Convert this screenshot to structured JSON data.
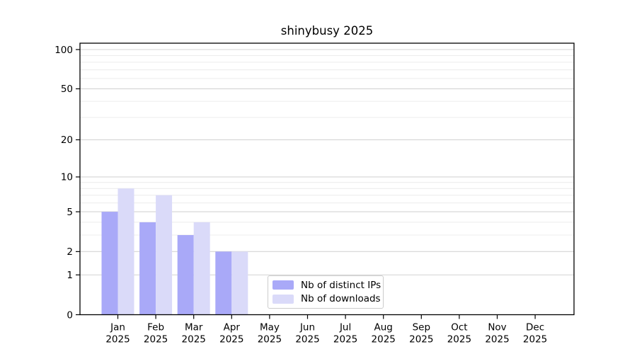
{
  "title": "shinybusy 2025",
  "chart_data": {
    "type": "bar",
    "title": "shinybusy 2025",
    "scale_y": "log1p",
    "xlabel": "",
    "ylabel": "",
    "year": "2025",
    "categories": [
      "Jan",
      "Feb",
      "Mar",
      "Apr",
      "May",
      "Jun",
      "Jul",
      "Aug",
      "Sep",
      "Oct",
      "Nov",
      "Dec"
    ],
    "series": [
      {
        "name": "Nb of distinct IPs",
        "color": "#a9a9f8",
        "values": [
          5,
          4,
          3,
          2,
          0,
          0,
          0,
          0,
          0,
          0,
          0,
          0
        ]
      },
      {
        "name": "Nb of downloads",
        "color": "#dadaf9",
        "values": [
          8,
          7,
          4,
          2,
          0,
          0,
          0,
          0,
          0,
          0,
          0,
          0
        ]
      }
    ],
    "y_tick_labels": [
      0,
      1,
      2,
      5,
      10,
      20,
      50,
      100
    ],
    "y_major_gridlines": [
      1,
      2,
      5,
      10,
      20,
      50,
      100
    ],
    "y_minor_gridlines": [
      3,
      4,
      6,
      7,
      8,
      9,
      30,
      40,
      60,
      70,
      80,
      90
    ],
    "ylim": [
      0,
      112
    ],
    "grid": true,
    "legend_position": "bottom-center",
    "colors": {
      "spine": "#000000",
      "major_grid": "#d4d4d4",
      "minor_grid": "#ececec",
      "legend_border": "#cccccc",
      "text": "#000000"
    }
  }
}
